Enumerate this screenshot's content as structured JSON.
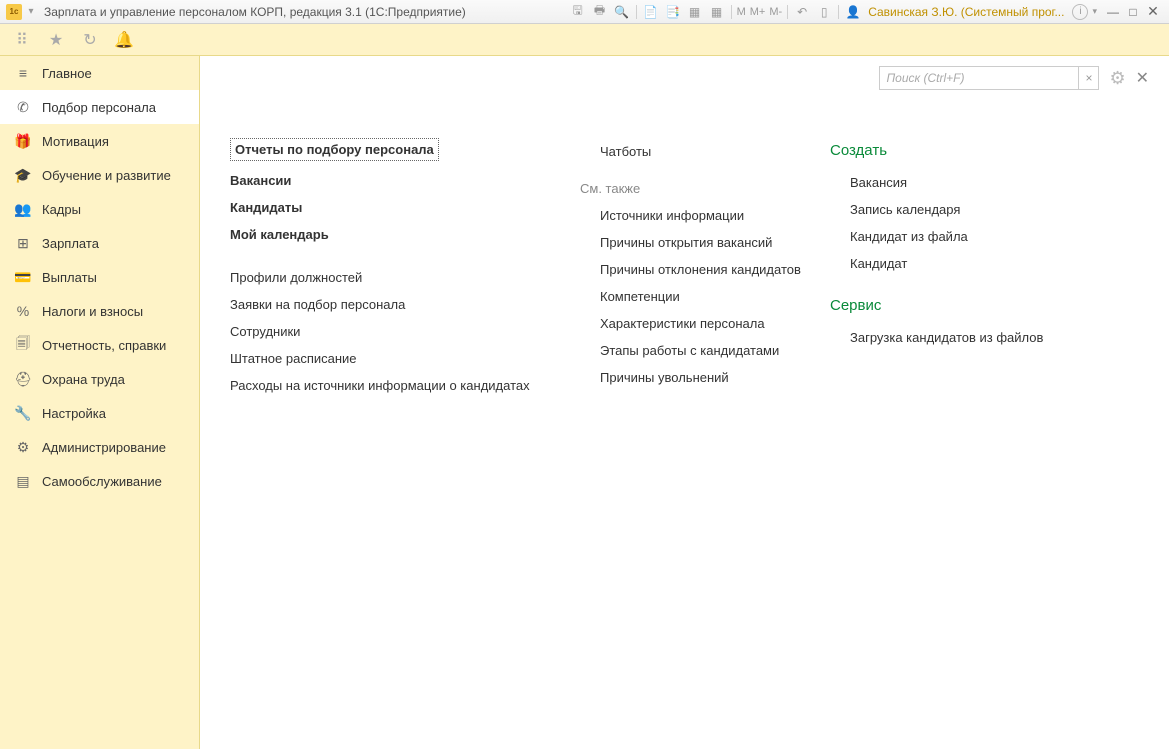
{
  "titlebar": {
    "title": "Зарплата и управление персоналом КОРП, редакция 3.1  (1С:Предприятие)",
    "m": "M",
    "mplus": "M+",
    "mminus": "M-",
    "user": "Савинская З.Ю. (Системный прог...",
    "info": "i"
  },
  "search": {
    "placeholder": "Поиск (Ctrl+F)",
    "clear": "×"
  },
  "sidebar": {
    "items": [
      {
        "icon": "≡",
        "label": "Главное"
      },
      {
        "icon": "✆",
        "label": "Подбор персонала"
      },
      {
        "icon": "🎁",
        "label": "Мотивация"
      },
      {
        "icon": "🎓",
        "label": "Обучение и развитие"
      },
      {
        "icon": "👥",
        "label": "Кадры"
      },
      {
        "icon": "⊞",
        "label": "Зарплата"
      },
      {
        "icon": "💳",
        "label": "Выплаты"
      },
      {
        "icon": "%",
        "label": "Налоги и взносы"
      },
      {
        "icon": "🗐",
        "label": "Отчетность, справки"
      },
      {
        "icon": "⛑",
        "label": "Охрана труда"
      },
      {
        "icon": "🔧",
        "label": "Настройка"
      },
      {
        "icon": "⚙",
        "label": "Администрирование"
      },
      {
        "icon": "▤",
        "label": "Самообслуживание"
      }
    ]
  },
  "col1": {
    "top": [
      "Отчеты по подбору персонала",
      "Вакансии",
      "Кандидаты",
      "Мой календарь"
    ],
    "bottom": [
      "Профили должностей",
      "Заявки на подбор персонала",
      "Сотрудники",
      "Штатное расписание",
      "Расходы на источники информации о кандидатах"
    ]
  },
  "col2": {
    "top": [
      "Чатботы"
    ],
    "header": "См. также",
    "items": [
      "Источники информации",
      "Причины открытия вакансий",
      "Причины отклонения кандидатов",
      "Компетенции",
      "Характеристики персонала",
      "Этапы работы с кандидатами",
      "Причины увольнений"
    ]
  },
  "col3": {
    "create_header": "Создать",
    "create": [
      "Вакансия",
      "Запись календаря",
      "Кандидат из файла",
      "Кандидат"
    ],
    "service_header": "Сервис",
    "service": [
      "Загрузка кандидатов из файлов"
    ]
  }
}
